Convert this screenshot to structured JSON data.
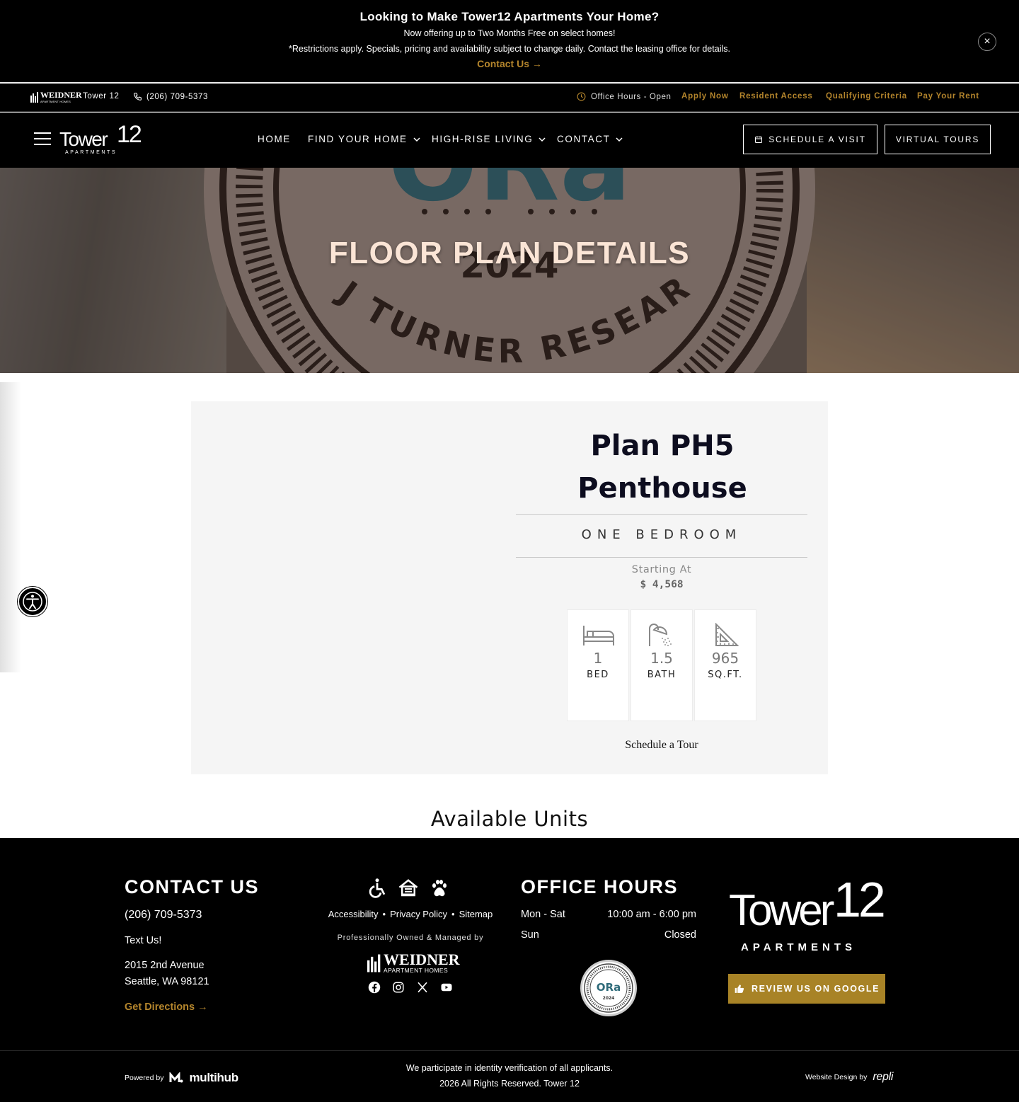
{
  "promo": {
    "title": "Looking to Make Tower12 Apartments Your Home?",
    "line1": "Now offering up to Two Months Free on select homes!",
    "line2": "*Restrictions apply. Specials, pricing and availability subject to change daily. Contact the leasing office for details.",
    "link": "Contact Us",
    "close": "×"
  },
  "utility": {
    "logo_text": "WEIDNER",
    "logo_sub": "APARTMENT HOMES",
    "community": "Tower 12",
    "phone": "(206) 709-5373",
    "hours": "Office Hours - Open",
    "links": [
      "Apply Now",
      "Resident Access",
      "Qualifying Criteria",
      "Pay Your Rent"
    ]
  },
  "nav": {
    "brand_main": "Tower",
    "brand_num": "12",
    "brand_sub": "APARTMENTS",
    "items": [
      "HOME",
      "FIND YOUR HOME",
      "HIGH-RISE LIVING",
      "CONTACT"
    ],
    "schedule": "SCHEDULE A VISIT",
    "virtual": "VIRTUAL TOURS"
  },
  "hero": {
    "title": "FLOOR PLAN DETAILS",
    "badge_text": "ORa",
    "badge_year": "2024",
    "badge_ring": "J TURNER RESEARCH"
  },
  "plan": {
    "title": "Plan PH5 Penthouse",
    "bed_type": "ONE BEDROOM",
    "starting_label": "Starting At",
    "price": "$ 4,568",
    "stats": [
      {
        "value": "1",
        "label": "BED",
        "icon": "bed-icon"
      },
      {
        "value": "1.5",
        "label": "BATH",
        "icon": "shower-icon"
      },
      {
        "value": "965",
        "label": "SQ.FT.",
        "icon": "ruler-triangle-icon"
      }
    ],
    "tour": "Schedule a Tour"
  },
  "available": "Available Units",
  "footer": {
    "contact_heading": "CONTACT US",
    "phone": "(206) 709-5373",
    "text_us": "Text Us!",
    "address1": "2015 2nd Avenue",
    "address2": "Seattle, WA 98121",
    "directions": "Get Directions",
    "links": [
      "Accessibility",
      "Privacy Policy",
      "Sitemap"
    ],
    "managed": "Professionally Owned & Managed by",
    "weidner": "WEIDNER",
    "weidner_sub": "APARTMENT HOMES",
    "hours_heading": "OFFICE HOURS",
    "hours": [
      {
        "day": "Mon - Sat",
        "time": "10:00 am - 6:00 pm"
      },
      {
        "day": "Sun",
        "time": "Closed"
      }
    ],
    "ora_text": "ORa",
    "ora_year": "2024",
    "brand_main": "Tower",
    "brand_num": "12",
    "brand_sub": "APARTMENTS",
    "review": "REVIEW US ON GOOGLE",
    "powered_by": "Powered by",
    "multihub": "multihub",
    "verify": "We participate in identity verification of all applicants.",
    "rights": "2026 All Rights Reserved. Tower 12",
    "design_by": "Website Design by",
    "repli": "repli"
  },
  "colors": {
    "gold": "#b4852c",
    "review_gold": "#a88326",
    "hero_title": "#fbe5d6",
    "badge_teal": "#2f6b7a"
  }
}
